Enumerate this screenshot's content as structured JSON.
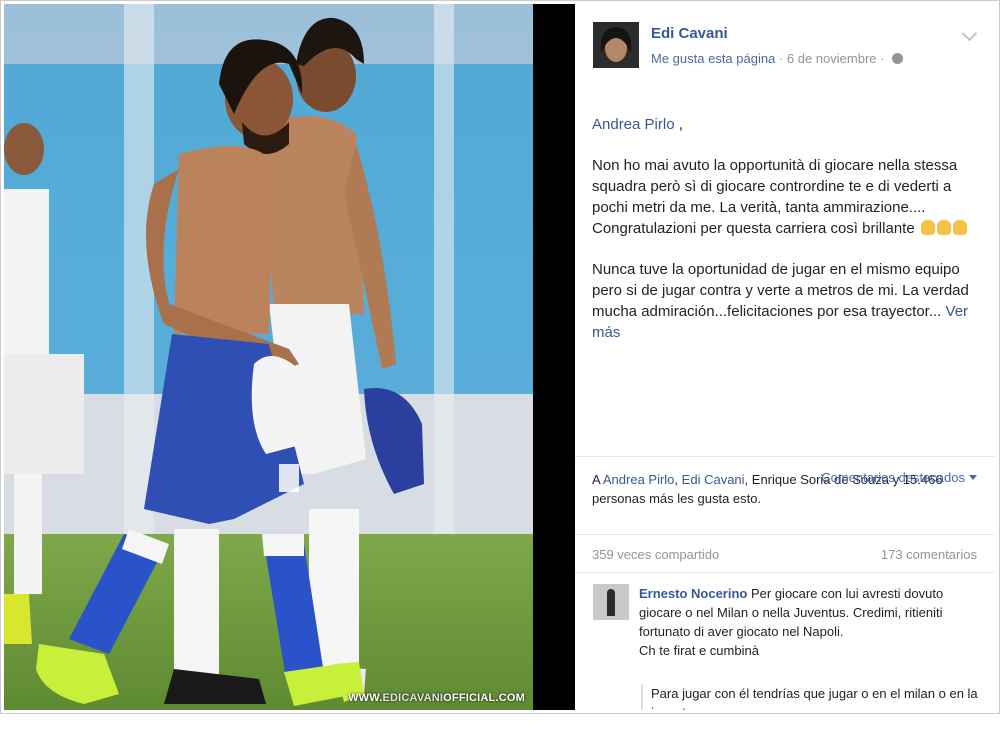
{
  "post": {
    "page_name": "Edi Cavani",
    "like_page_label": "Me gusta esta página",
    "date": "6 de noviembre",
    "privacy_icon": "globe-icon",
    "mention": "Andrea Pirlo",
    "mention_suffix": " ,",
    "paragraph_italian": "Non ho mai avuto la opportunità di giocare nella stessa squadra però sì di giocare contrordine te e di vederti a pochi metri da me. La verità, tanta ammirazione.... Congratulazioni per questa carriera così brillante",
    "paragraph_spanish": "Nunca tuve la oportunidad de jugar en el mismo equipo pero si de jugar contra y verte a metros de mi. La verdad mucha admiración...felicitaciones por esa trayector...",
    "see_more": "Ver más"
  },
  "photo": {
    "watermark_prefix": "WWW.",
    "watermark_brand": "EDICAVANI",
    "watermark_suffix": "OFFICIAL.COM"
  },
  "reactions": {
    "prefix": "A",
    "name1": "Andrea Pirlo",
    "sep": ",",
    "name2": "Edi Cavani",
    "rest": ", Enrique Soria de Souza y 15.466 personas más les gusta esto.",
    "top_comments_label": "Comentarios destacados",
    "shares": "359 veces compartido",
    "comments_count": "173 comentarios"
  },
  "comment": {
    "author": "Ernesto Nocerino",
    "text": "Per giocare con lui avresti dovuto giocare o nel Milan o nella Juventus. Credimi, ritieniti fortunato di aver giocato nel Napoli.",
    "text2": "Ch te firat e cumbinà",
    "translation": "Para jugar con él tendrías que jugar o en el milan o en la juventus"
  },
  "colors": {
    "link": "#365899",
    "muted": "#90949c",
    "text": "#1d2129",
    "shorts": "#2f4fb5",
    "boots": "#c8f03a"
  }
}
